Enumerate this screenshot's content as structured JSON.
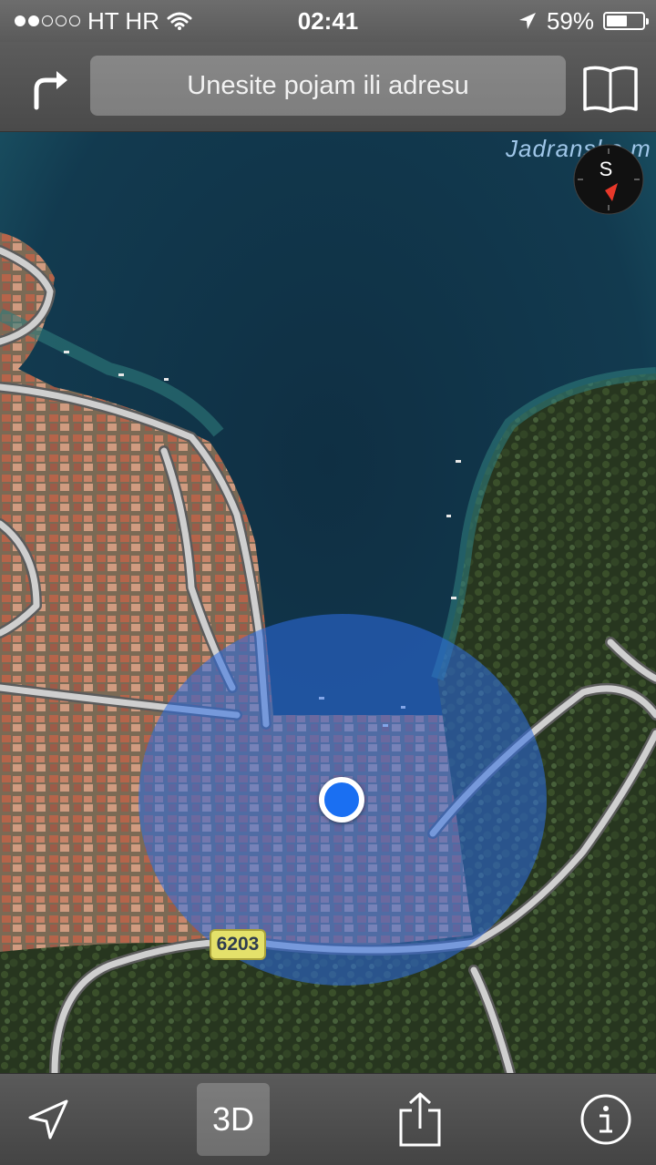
{
  "status_bar": {
    "carrier": "HT HR",
    "time": "02:41",
    "battery_percent": "59%",
    "battery_level": 0.59,
    "signal_bars_filled": 2,
    "signal_bars_total": 5
  },
  "nav_bar": {
    "search_placeholder": "Unesite pojam ili adresu",
    "directions_icon": "turn-arrow-icon",
    "bookmarks_icon": "book-icon"
  },
  "map": {
    "sea_label": "Jadransko m",
    "compass_letter": "S",
    "road_number": "6203",
    "view": "satellite"
  },
  "toolbar": {
    "locate_icon": "location-arrow-icon",
    "three_d_label": "3D",
    "share_icon": "share-icon",
    "info_icon": "info-icon"
  },
  "colors": {
    "accuracy_circle": "#2d6ee6",
    "location_dot": "#1a6ff2",
    "road_shield": "#e4e16a"
  }
}
